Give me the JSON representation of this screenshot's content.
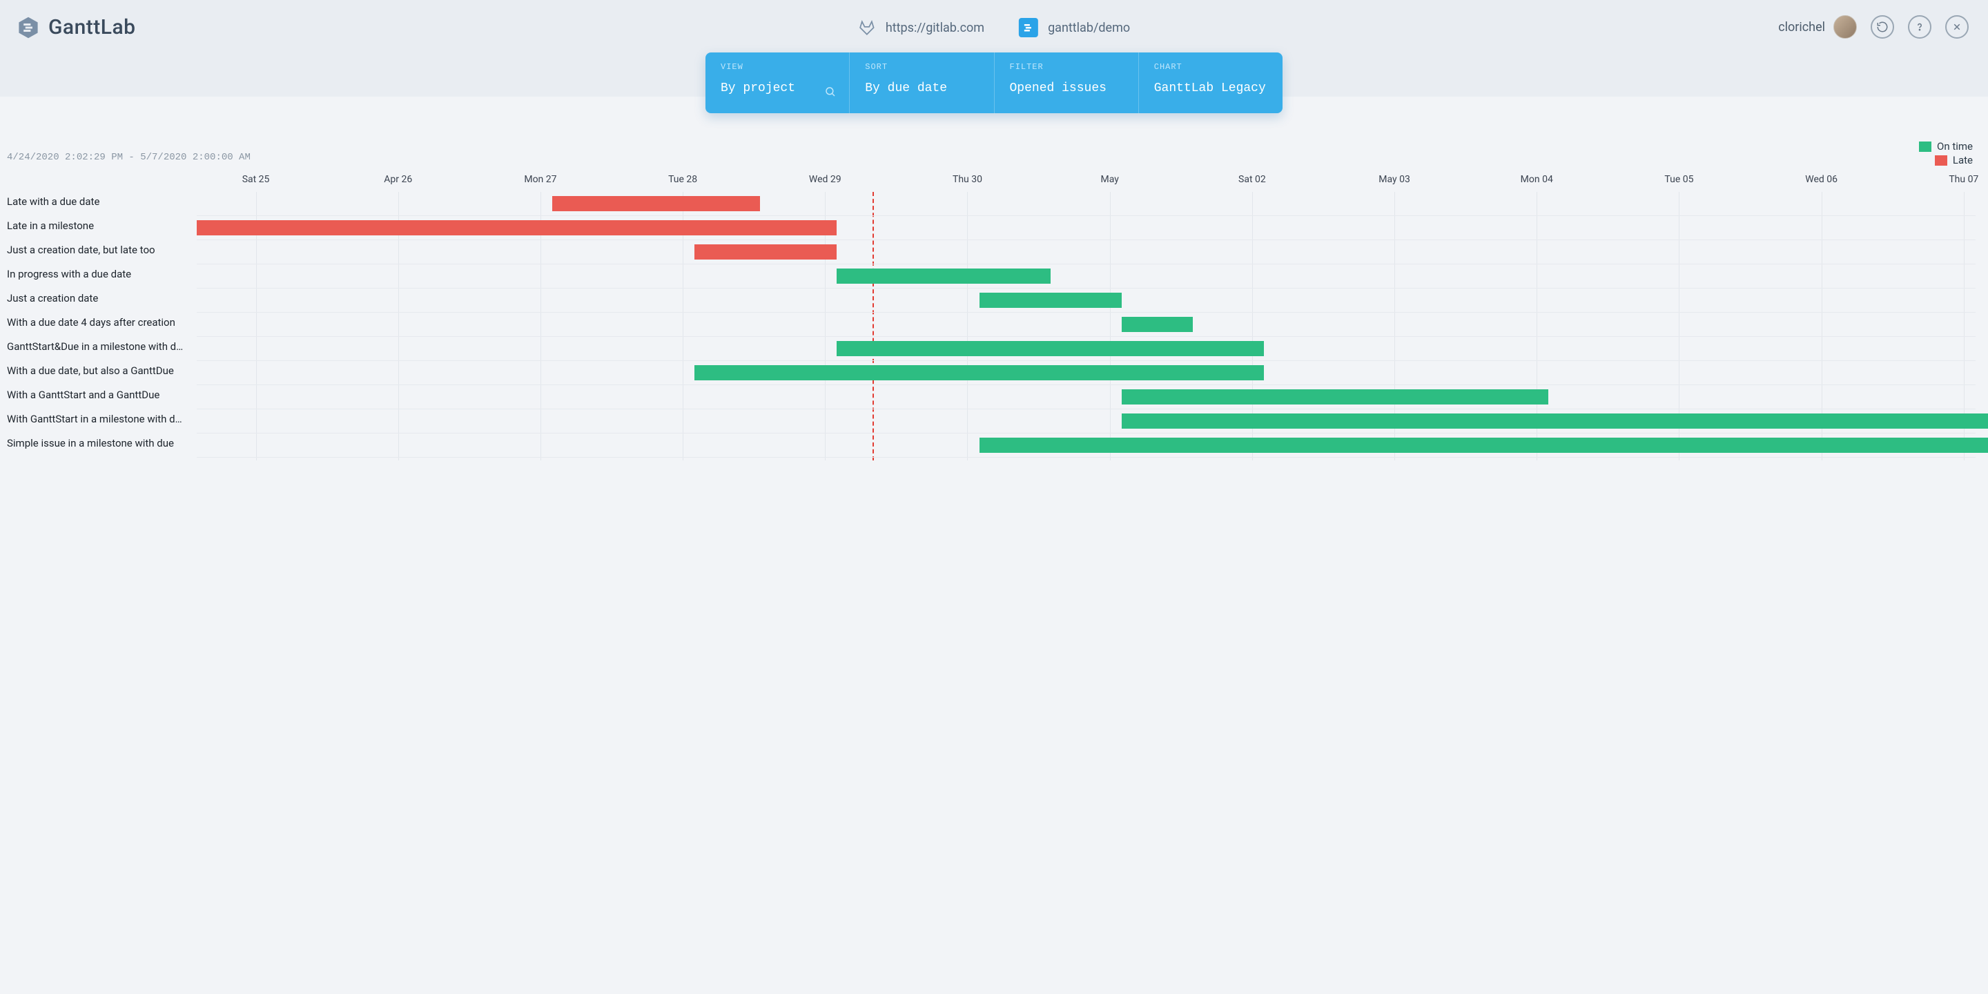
{
  "brand": {
    "title": "GanttLab"
  },
  "header": {
    "gitlab_url": "https://gitlab.com",
    "project_path": "ganttlab/demo",
    "username": "clorichel"
  },
  "controls": {
    "view": {
      "label": "VIEW",
      "value": "By project"
    },
    "sort": {
      "label": "SORT",
      "value": "By due date"
    },
    "filter": {
      "label": "FILTER",
      "value": "Opened issues"
    },
    "chart": {
      "label": "CHART",
      "value": "GanttLab Legacy"
    }
  },
  "legend": {
    "on_time": "On time",
    "late": "Late"
  },
  "date_range": "4/24/2020 2:02:29 PM - 5/7/2020 2:00:00 AM",
  "chart_data": {
    "type": "bar",
    "x_axis": {
      "start": "2020-04-24T14:02:29",
      "end": "2020-05-07T02:00:00",
      "today": "2020-04-29T08:00:00",
      "ticks": [
        {
          "label": "Sat 25",
          "date": "2020-04-25"
        },
        {
          "label": "Apr 26",
          "date": "2020-04-26"
        },
        {
          "label": "Mon 27",
          "date": "2020-04-27"
        },
        {
          "label": "Tue 28",
          "date": "2020-04-28"
        },
        {
          "label": "Wed 29",
          "date": "2020-04-29"
        },
        {
          "label": "Thu 30",
          "date": "2020-04-30"
        },
        {
          "label": "May",
          "date": "2020-05-01"
        },
        {
          "label": "Sat 02",
          "date": "2020-05-02"
        },
        {
          "label": "May 03",
          "date": "2020-05-03"
        },
        {
          "label": "Mon 04",
          "date": "2020-05-04"
        },
        {
          "label": "Tue 05",
          "date": "2020-05-05"
        },
        {
          "label": "Wed 06",
          "date": "2020-05-06"
        },
        {
          "label": "Thu 07",
          "date": "2020-05-07"
        }
      ]
    },
    "tasks": [
      {
        "label": "Late with a due date",
        "start": "2020-04-27T02:00",
        "end": "2020-04-28T13:00",
        "status": "late"
      },
      {
        "label": "Late in a milestone",
        "start": "2020-04-24T14:00",
        "end": "2020-04-29T02:00",
        "status": "late"
      },
      {
        "label": "Just a creation date, but late too",
        "start": "2020-04-28T02:00",
        "end": "2020-04-29T02:00",
        "status": "late"
      },
      {
        "label": "In progress with a due date",
        "start": "2020-04-29T02:00",
        "end": "2020-04-30T14:00",
        "status": "on_time"
      },
      {
        "label": "Just a creation date",
        "start": "2020-04-30T02:00",
        "end": "2020-05-01T02:00",
        "status": "on_time"
      },
      {
        "label": "With a due date 4 days after creation",
        "start": "2020-05-01T02:00",
        "end": "2020-05-01T14:00",
        "status": "on_time"
      },
      {
        "label": "GanttStart&Due in a milestone with due",
        "start": "2020-04-29T02:00",
        "end": "2020-05-02T02:00",
        "status": "on_time"
      },
      {
        "label": "With a due date, but also a GanttDue",
        "start": "2020-04-28T02:00",
        "end": "2020-05-02T02:00",
        "status": "on_time"
      },
      {
        "label": "With a GanttStart and a GanttDue",
        "start": "2020-05-01T02:00",
        "end": "2020-05-04T02:00",
        "status": "on_time"
      },
      {
        "label": "With GanttStart in a milestone with due",
        "start": "2020-05-01T02:00",
        "end": "2020-05-07T14:00",
        "status": "on_time"
      },
      {
        "label": "Simple issue in a milestone with due",
        "start": "2020-04-30T02:00",
        "end": "2020-05-07T14:00",
        "status": "on_time"
      }
    ]
  }
}
